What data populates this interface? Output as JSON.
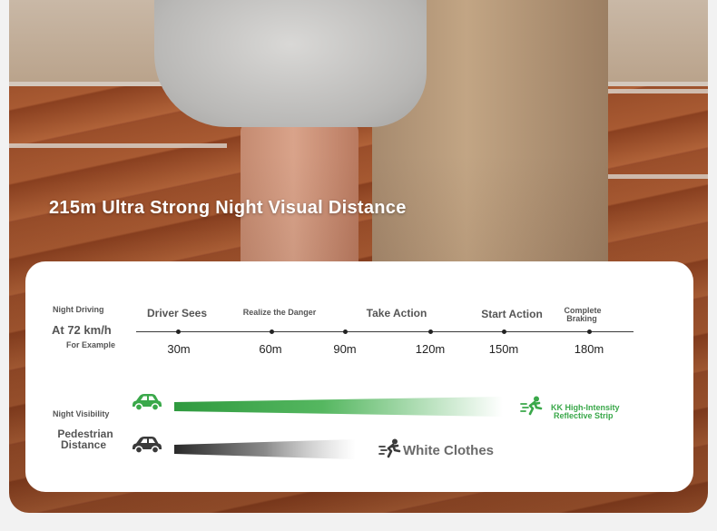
{
  "headline": "215m Ultra Strong Night Visual Distance",
  "scale": {
    "night_driving": "Night Driving",
    "speed": "At 72 km/h",
    "for_example": "For Example",
    "stages": [
      {
        "label": "Driver Sees"
      },
      {
        "label": "Realize the Danger"
      },
      {
        "label": "Take Action"
      },
      {
        "label": "Start Action"
      },
      {
        "label_line1": "Complete",
        "label_line2": "Braking"
      }
    ],
    "ticks": [
      "30m",
      "60m",
      "90m",
      "120m",
      "150m",
      "180m"
    ]
  },
  "visibility": {
    "night_visibility_label": "Night Visibility",
    "pedestrian_line1": "Pedestrian",
    "pedestrian_line2": "Distance",
    "reflective_line1": "KK High-Intensity",
    "reflective_line2": "Reflective Strip",
    "white_clothes": "White Clothes",
    "colors": {
      "green": "#3aa84a",
      "dark": "#3a3a3a"
    }
  }
}
